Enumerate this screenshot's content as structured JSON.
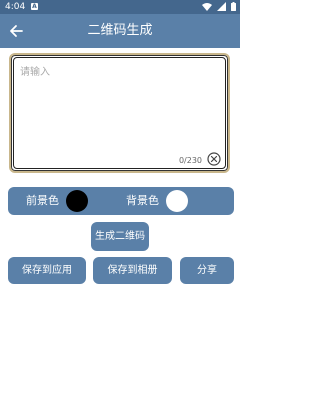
{
  "status_bar": {
    "time": "4:04",
    "notification_letter": "A"
  },
  "app_bar": {
    "title": "二维码生成",
    "back_icon": "arrow-left-icon"
  },
  "input": {
    "placeholder": "请输入",
    "value": "",
    "counter": "0/230",
    "clear_icon": "clear-circle-icon"
  },
  "colors": {
    "foreground_label": "前景色",
    "background_label": "背景色",
    "foreground_color": "#000000",
    "background_color": "#ffffff",
    "accent": "#5a80a8",
    "status_bar": "#44678d",
    "border": "#c9b78c"
  },
  "buttons": {
    "generate": "生成二维码",
    "save_to_app": "保存到应用",
    "save_to_album": "保存到相册",
    "share": "分享"
  }
}
